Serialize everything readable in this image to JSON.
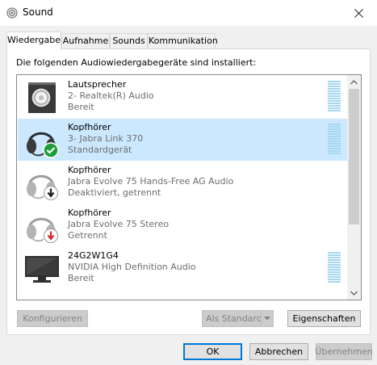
{
  "window": {
    "title": "Sound"
  },
  "tabs": [
    {
      "label": "Wiedergabe",
      "active": true
    },
    {
      "label": "Aufnahme",
      "active": false
    },
    {
      "label": "Sounds",
      "active": false
    },
    {
      "label": "Kommunikation",
      "active": false
    }
  ],
  "panel": {
    "heading": "Die folgenden Audiowiedergabegeräte sind installiert:"
  },
  "devices": [
    {
      "name": "Lautsprecher",
      "description": "2- Realtek(R) Audio",
      "status": "Bereit",
      "icon": "speaker-icon",
      "selected": false
    },
    {
      "name": "Kopfhörer",
      "description": "3- Jabra Link 370",
      "status": "Standardgerät",
      "icon": "headset-icon",
      "badge": "default-check-badge",
      "selected": true
    },
    {
      "name": "Kopfhörer",
      "description": "Jabra Evolve 75 Hands-Free AG Audio",
      "status": "Deaktiviert, getrennt",
      "icon": "headset-icon",
      "badge": "disabled-arrow-badge",
      "selected": false
    },
    {
      "name": "Kopfhörer",
      "description": "Jabra Evolve 75 Stereo",
      "status": "Getrennt",
      "icon": "headset-icon",
      "badge": "disconnected-arrow-badge",
      "selected": false
    },
    {
      "name": "24G2W1G4",
      "description": "NVIDIA High Definition Audio",
      "status": "Bereit",
      "icon": "monitor-icon",
      "selected": false
    }
  ],
  "buttons": {
    "configure": "Konfigurieren",
    "set_default": "Als Standard",
    "properties": "Eigenschaften",
    "ok": "OK",
    "cancel": "Abbrechen",
    "apply": "Übernehmen"
  },
  "colors": {
    "selection": "#cce8ff",
    "accent": "#0078d7",
    "meter": "#a6d7f0",
    "check_badge": "#1e9e3a",
    "disconnected_arrow": "#d42a2a"
  }
}
